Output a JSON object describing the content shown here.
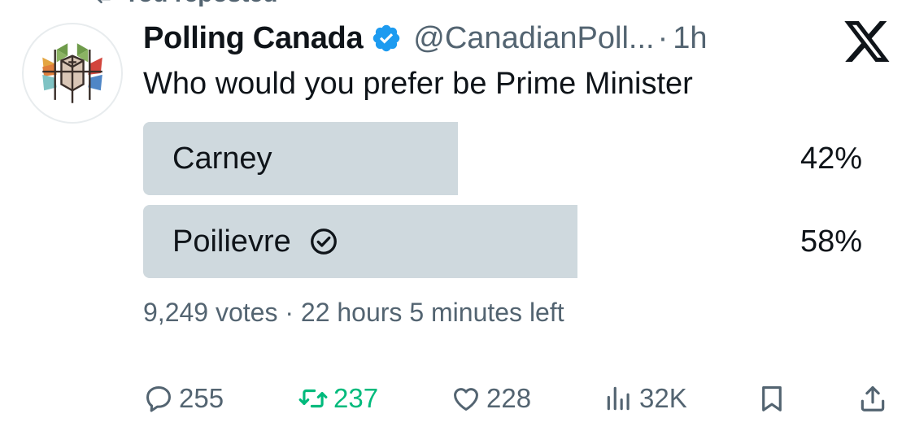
{
  "repost_banner": {
    "label": "You reposted"
  },
  "author": {
    "display_name": "Polling Canada",
    "handle": "@CanadianPoll...",
    "separator": "·",
    "time": "1h",
    "verified": true
  },
  "tweet": {
    "text": "Who would you prefer be Prime Minister"
  },
  "poll": {
    "options": [
      {
        "label": "Carney",
        "percent_text": "42%",
        "percent": 42,
        "selected": false
      },
      {
        "label": "Poilievre",
        "percent_text": "58%",
        "percent": 58,
        "selected": true
      }
    ],
    "meta": "9,249 votes · 22 hours 5 minutes left"
  },
  "actions": {
    "replies": "255",
    "reposts": "237",
    "likes": "228",
    "views": "32K"
  },
  "colors": {
    "accent_blue": "#1d9bf0",
    "repost_green": "#00ba7c",
    "poll_bar": "#cfd9de",
    "secondary_text": "#536471",
    "primary_text": "#0f1419"
  },
  "icons": {
    "repost_banner": "repost-icon",
    "verified": "verified-badge-icon",
    "platform": "x-logo-icon",
    "selected_choice": "check-circle-icon",
    "reply": "reply-icon",
    "repost": "repost-icon",
    "like": "heart-icon",
    "views": "views-icon",
    "bookmark": "bookmark-icon",
    "share": "share-icon"
  }
}
